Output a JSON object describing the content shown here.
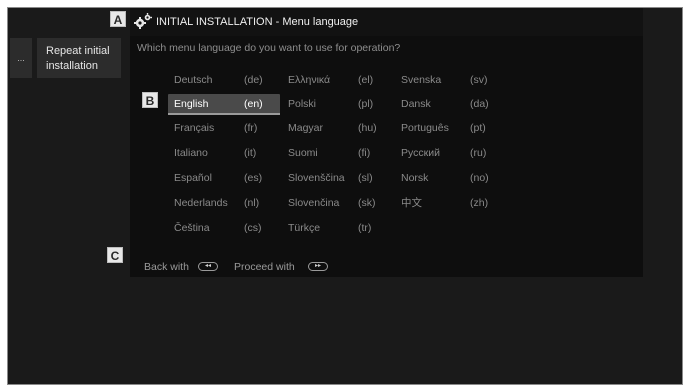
{
  "header": {
    "title": "INITIAL INSTALLATION - Menu language",
    "icon": "gear-icon"
  },
  "sidebar": {
    "more": "...",
    "repeat_line1": "Repeat initial",
    "repeat_line2": "installation"
  },
  "prompt": "Which menu language do you want to use for operation?",
  "languages": [
    {
      "name": "Deutsch",
      "code": "(de)"
    },
    {
      "name": "Ελληνικά",
      "code": "(el)"
    },
    {
      "name": "Svenska",
      "code": "(sv)"
    },
    {
      "name": "English",
      "code": "(en)"
    },
    {
      "name": "Polski",
      "code": "(pl)"
    },
    {
      "name": "Dansk",
      "code": "(da)"
    },
    {
      "name": "Français",
      "code": "(fr)"
    },
    {
      "name": "Magyar",
      "code": "(hu)"
    },
    {
      "name": "Português",
      "code": "(pt)"
    },
    {
      "name": "Italiano",
      "code": "(it)"
    },
    {
      "name": "Suomi",
      "code": "(fi)"
    },
    {
      "name": "Русский",
      "code": "(ru)"
    },
    {
      "name": "Español",
      "code": "(es)"
    },
    {
      "name": "Slovenščina",
      "code": "(sl)"
    },
    {
      "name": "Norsk",
      "code": "(no)"
    },
    {
      "name": "Nederlands",
      "code": "(nl)"
    },
    {
      "name": "Slovenčina",
      "code": "(sk)"
    },
    {
      "name": "中文",
      "code": "(zh)"
    },
    {
      "name": "Čeština",
      "code": "(cs)"
    },
    {
      "name": "Türkçe",
      "code": "(tr)"
    }
  ],
  "selected_language": "English",
  "footer": {
    "back": "Back with",
    "proceed": "Proceed with",
    "back_key": "◂◂",
    "proceed_key": "▸▸"
  },
  "markers": {
    "a": "A",
    "b": "B",
    "c": "C"
  }
}
